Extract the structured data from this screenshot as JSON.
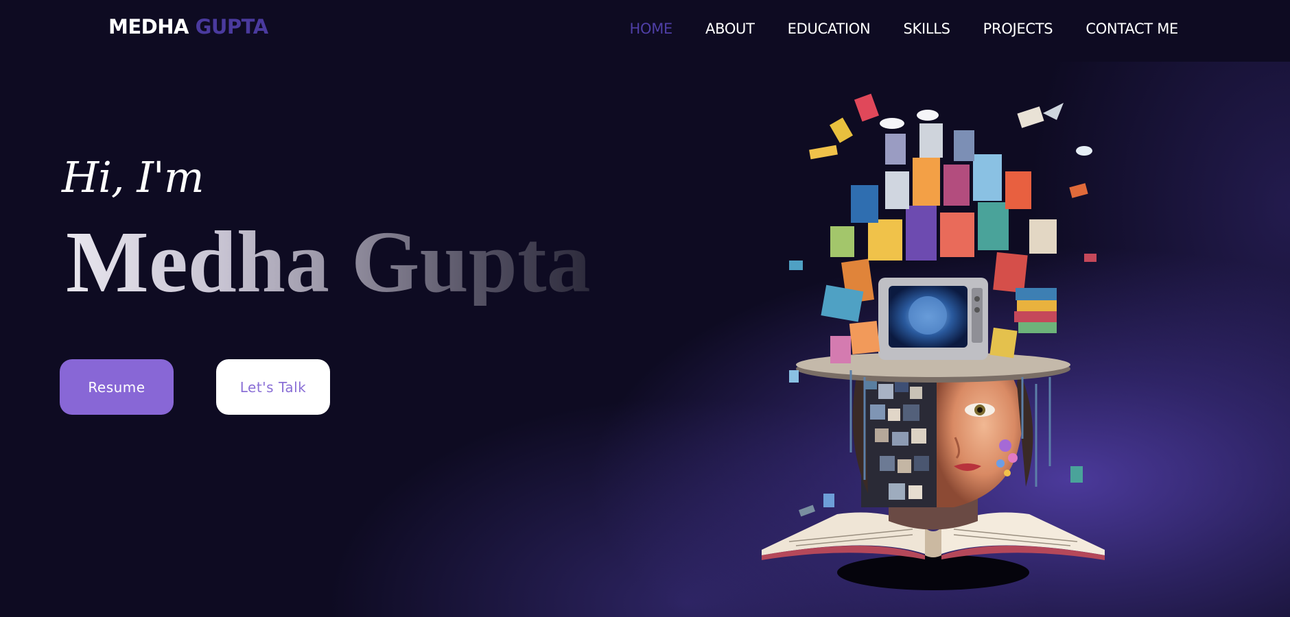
{
  "header": {
    "logo_first": "MEDHA",
    "logo_second": "GUPTA",
    "nav": [
      {
        "label": "HOME",
        "active": true
      },
      {
        "label": "ABOUT",
        "active": false
      },
      {
        "label": "EDUCATION",
        "active": false
      },
      {
        "label": "SKILLS",
        "active": false
      },
      {
        "label": "PROJECTS",
        "active": false
      },
      {
        "label": "CONTACT ME",
        "active": false
      }
    ]
  },
  "hero": {
    "greeting": "Hi, I'm",
    "name": "Medha Gupta",
    "buttons": {
      "resume_label": "Resume",
      "talk_label": "Let's Talk"
    }
  },
  "colors": {
    "background": "#0e0b22",
    "accent": "#4a3a9e",
    "button_primary": "#8867d6",
    "button_secondary_text": "#8a6fd6",
    "glow": "#5642b0"
  },
  "icons": {
    "illustration": "book-head-collage-illustration"
  }
}
